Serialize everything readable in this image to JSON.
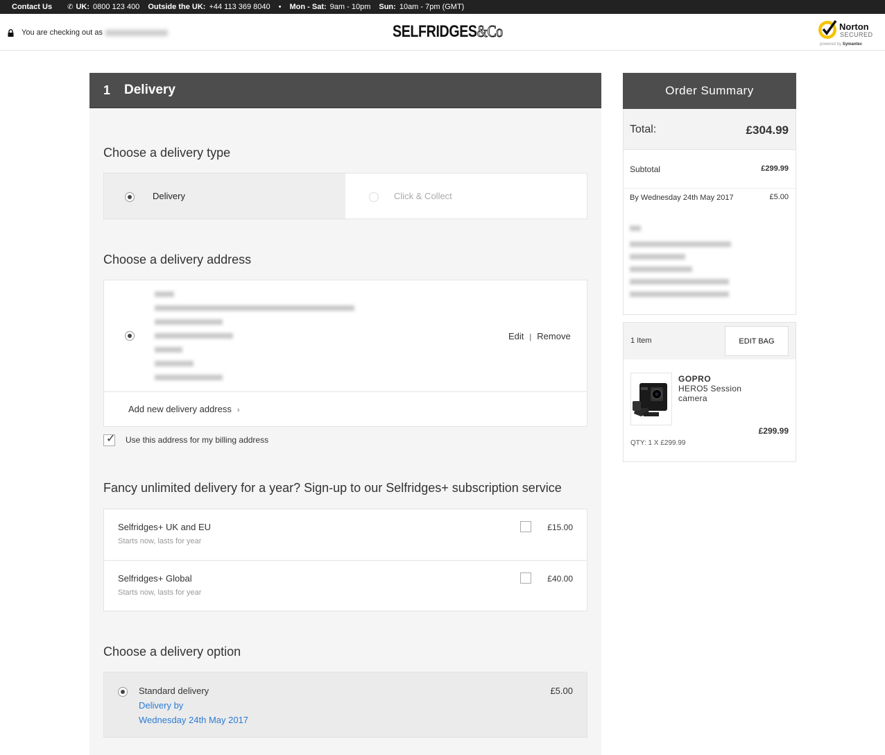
{
  "topbar": {
    "contact": "Contact Us",
    "uk_label": "UK:",
    "uk_phone": "0800 123 400",
    "outside_label": "Outside the UK:",
    "outside_phone": "+44 113 369 8040",
    "dot": "•",
    "monsat_label": "Mon - Sat:",
    "monsat_hours": "9am - 10pm",
    "sun_label": "Sun:",
    "sun_hours": "10am - 7pm (GMT)"
  },
  "header": {
    "checkout_text": "You are checking out as",
    "logo": "SELFRIDGES",
    "logo_co": "&Co",
    "norton": "Norton",
    "norton_secured": "SECURED",
    "norton_powered": "powered by",
    "norton_symantec": "Symantec"
  },
  "delivery": {
    "step_number": "1",
    "title": "Delivery",
    "type_heading": "Choose a delivery type",
    "type_delivery": "Delivery",
    "type_click_collect": "Click & Collect",
    "address_heading": "Choose a delivery address",
    "edit": "Edit",
    "pipe": "|",
    "remove": "Remove",
    "add_address": "Add new delivery address",
    "add_chevron": "›",
    "billing_label": "Use this address for my billing address",
    "subscription_heading": "Fancy unlimited delivery for a year? Sign-up to our Selfridges+ subscription service",
    "subscriptions": [
      {
        "title": "Selfridges+ UK and EU",
        "desc": "Starts now, lasts for year",
        "price": "£15.00"
      },
      {
        "title": "Selfridges+ Global",
        "desc": "Starts now, lasts for year",
        "price": "£40.00"
      }
    ],
    "option_heading": "Choose a delivery option",
    "option_title": "Standard delivery",
    "option_line1": "Delivery by",
    "option_line2": "Wednesday 24th May 2017",
    "option_price": "£5.00"
  },
  "summary": {
    "title": "Order Summary",
    "total_label": "Total:",
    "total_value": "£304.99",
    "subtotal_label": "Subtotal",
    "subtotal_value": "£299.99",
    "delivery_date": "By Wednesday 24th May 2017",
    "delivery_value": "£5.00"
  },
  "bag": {
    "count": "1 Item",
    "edit_bag": "EDIT BAG",
    "brand": "GOPRO",
    "product": "HERO5 Session camera",
    "price": "£299.99",
    "qty": "QTY: 1 X £299.99"
  },
  "colors": {
    "header_dark": "#4d4d4d",
    "topbar": "#222222",
    "link_blue": "#2a7bd4",
    "panel_bg": "#f5f5f5"
  }
}
